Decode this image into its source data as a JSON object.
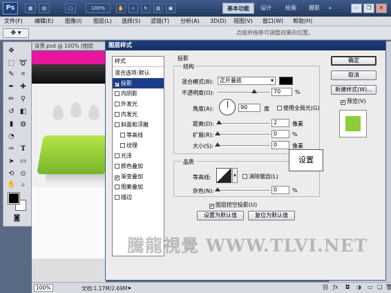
{
  "titlebar": {
    "logo": "Ps",
    "zoom": "100%",
    "workspaces": [
      "基本功能",
      "设计",
      "绘画",
      "摄影"
    ],
    "expand": "»"
  },
  "menu": [
    "文件(F)",
    "编辑(E)",
    "图像(I)",
    "图层(L)",
    "选择(S)",
    "滤镜(T)",
    "分析(A)",
    "3D(D)",
    "视图(V)",
    "窗口(W)",
    "帮助(H)"
  ],
  "options_bar": {
    "hint": "点按并拖移可调整效果的位置。"
  },
  "document": {
    "tab_title": "背景.psd @ 100% (图层",
    "zoom": "100%",
    "doc_size": "文档:1.17M/2.69M"
  },
  "dialog": {
    "title": "图层样式",
    "styles_header": "样式",
    "styles": [
      {
        "label": "混合选项:默认",
        "checkbox": false,
        "checked": false,
        "selected": false
      },
      {
        "label": "投影",
        "checkbox": true,
        "checked": true,
        "selected": true
      },
      {
        "label": "内阴影",
        "checkbox": true,
        "checked": false,
        "selected": false
      },
      {
        "label": "外发光",
        "checkbox": true,
        "checked": false,
        "selected": false
      },
      {
        "label": "内发光",
        "checkbox": true,
        "checked": false,
        "selected": false
      },
      {
        "label": "斜面和浮雕",
        "checkbox": true,
        "checked": false,
        "selected": false
      },
      {
        "label": "等高线",
        "checkbox": true,
        "checked": false,
        "selected": false,
        "indent": true
      },
      {
        "label": "纹理",
        "checkbox": true,
        "checked": false,
        "selected": false,
        "indent": true
      },
      {
        "label": "光泽",
        "checkbox": true,
        "checked": false,
        "selected": false
      },
      {
        "label": "颜色叠加",
        "checkbox": true,
        "checked": false,
        "selected": false
      },
      {
        "label": "渐变叠加",
        "checkbox": true,
        "checked": true,
        "selected": false
      },
      {
        "label": "图案叠加",
        "checkbox": true,
        "checked": false,
        "selected": false
      },
      {
        "label": "描边",
        "checkbox": true,
        "checked": false,
        "selected": false
      }
    ],
    "section_title": "投影",
    "structure": {
      "title": "结构",
      "blend_mode_label": "混合模式(B):",
      "blend_mode_value": "正片叠底",
      "shadow_color": "#000000",
      "opacity_label": "不透明度(O):",
      "opacity_value": "70",
      "opacity_unit": "%",
      "angle_label": "角度(A):",
      "angle_value": "90",
      "angle_unit": "度",
      "global_light_label": "使用全局光(G)",
      "global_light_checked": false,
      "distance_label": "距离(D):",
      "distance_value": "2",
      "distance_unit": "像素",
      "spread_label": "扩展(R):",
      "spread_value": "0",
      "spread_unit": "%",
      "size_label": "大小(S):",
      "size_value": "0",
      "size_unit": "像素"
    },
    "quality": {
      "title": "品质",
      "contour_label": "等高线:",
      "antialias_label": "消除锯齿(L)",
      "noise_label": "杂色(N):",
      "noise_value": "0",
      "noise_unit": "%"
    },
    "knockout_label": "图层挖空投影(U)",
    "knockout_checked": true,
    "make_default": "设置为默认值",
    "reset_default": "复位为默认值",
    "buttons": {
      "ok": "确定",
      "cancel": "取消",
      "new_style": "新建样式(W)...",
      "preview_label": "预览(V)",
      "preview_checked": true
    },
    "preview_color": "#8fcc3a"
  },
  "callout": "设置",
  "watermark": "騰龍視覺 WWW.TLVI.NET",
  "colors": {
    "accent": "#1c3d8c",
    "document_magenta": "#e8169c",
    "document_green": "#9ed03c"
  }
}
